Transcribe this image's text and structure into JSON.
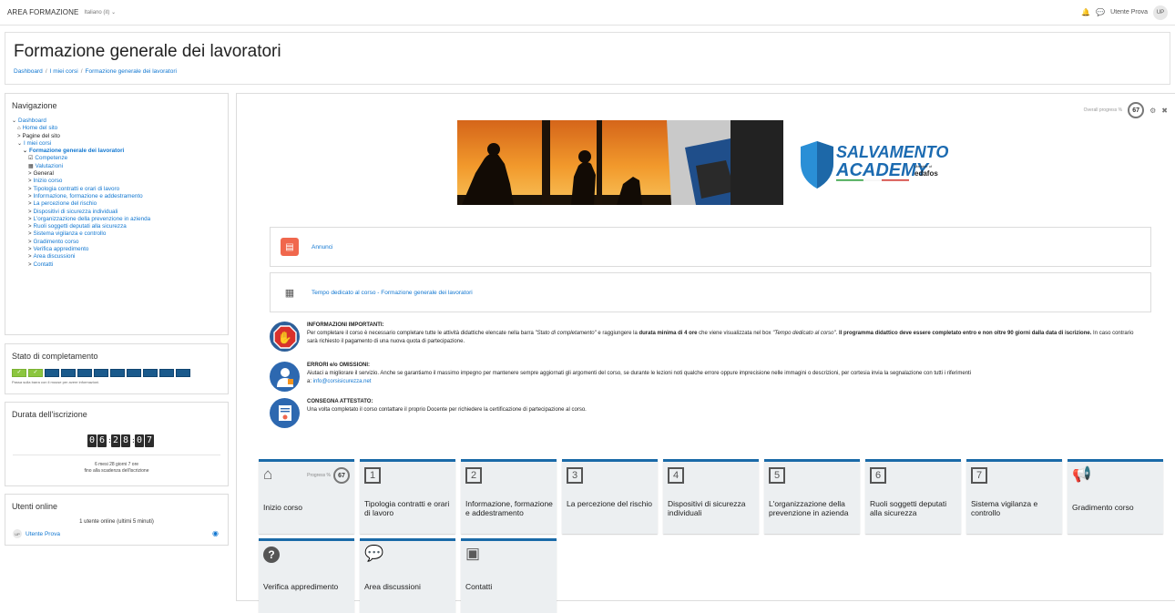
{
  "topbar": {
    "brand": "AREA FORMAZIONE",
    "language": "Italiano (it) ⌄",
    "user_name": "Utente Prova",
    "user_initials": "UP"
  },
  "header": {
    "title": "Formazione generale dei lavoratori",
    "breadcrumb": [
      "Dashboard",
      "I miei corsi",
      "Formazione generale dei lavoratori"
    ]
  },
  "navigation": {
    "title": "Navigazione",
    "items": [
      {
        "label": "Dashboard",
        "prefix": "⌄"
      },
      {
        "label": "Home del sito",
        "prefix": "⌂"
      },
      {
        "label": "Pagine del sito",
        "prefix": ">"
      },
      {
        "label": "I miei corsi",
        "prefix": "⌄"
      },
      {
        "label": "Formazione generale dei lavoratori",
        "prefix": "⌄"
      },
      {
        "label": "Competenze",
        "prefix": "☑"
      },
      {
        "label": "Valutazioni",
        "prefix": "▦"
      },
      {
        "label": "General",
        "prefix": ">"
      },
      {
        "label": "Inizio corso",
        "prefix": ">"
      },
      {
        "label": "Tipologia contratti e orari di lavoro",
        "prefix": ">"
      },
      {
        "label": "Informazione, formazione e addestramento",
        "prefix": ">"
      },
      {
        "label": "La percezione del rischio",
        "prefix": ">"
      },
      {
        "label": "Dispositivi di sicurezza individuali",
        "prefix": ">"
      },
      {
        "label": "L'organizzazione della prevenzione in azienda",
        "prefix": ">"
      },
      {
        "label": "Ruoli soggetti deputati alla sicurezza",
        "prefix": ">"
      },
      {
        "label": "Sistema vigilanza e controllo",
        "prefix": ">"
      },
      {
        "label": "Gradimento corso",
        "prefix": ">"
      },
      {
        "label": "Verifica appredimento",
        "prefix": ">"
      },
      {
        "label": "Area discussioni",
        "prefix": ">"
      },
      {
        "label": "Contatti",
        "prefix": ">"
      }
    ]
  },
  "completion": {
    "title": "Stato di completamento",
    "completed": 2,
    "total": 11,
    "check": "✓",
    "hint": "Passa sulla barra con il mouse per avere informazioni."
  },
  "duration": {
    "title": "Durata dell'iscrizione",
    "digits": [
      "0",
      "6",
      "2",
      "8",
      "0",
      "7"
    ],
    "remaining_line1": "6 mesi 28 giorni 7 ore",
    "remaining_line2": "fino alla scadenza dell'iscrizione"
  },
  "online_users": {
    "title": "Utenti online",
    "count_text": "1 utente online (ultimi 5 minuti)",
    "user_name": "Utente Prova",
    "user_initials": "UP"
  },
  "main": {
    "overall_progress_label": "Overall progress %",
    "overall_progress_value": "67",
    "logo_line1": "SALVAMENTO",
    "logo_line2": "ACADEMY",
    "logo_member": "Member of",
    "logo_brand": "edafos",
    "activities": [
      {
        "label": "Annunci"
      },
      {
        "label": "Tempo dedicato al corso - Formazione generale dei lavoratori"
      }
    ],
    "info": [
      {
        "heading": "INFORMAZIONI IMPORTANTI:",
        "p1": "Per completare il corso è necessario completare tutte le attività didattiche elencate nella barra ",
        "p1_em": "\"Stato di completamento\"",
        "p2": " e raggiungere la ",
        "p2_b": "durata minima di 4 ore",
        "p3": " che viene visualizzata nel box ",
        "p3_em": "\"Tempo dedicato al corso\"",
        "p4": ". ",
        "p4_b": "Il programma didattico deve essere completato entro e non oltre 90 giorni dalla data di iscrizione.",
        "p5": " In caso contrario sarà richiesto il pagamento di una nuova quota di partecipazione."
      },
      {
        "heading": "ERRORI e/o OMISSIONI:",
        "text": "Aiutaci a migliorare il servizio. Anche se garantiamo il massimo impegno per mantenere sempre aggiornati gli argomenti del corso, se durante le lezioni noti qualche errore oppure imprecisione nelle immagini o descrizioni, per cortesia invia la segnalazione con tutti i riferimenti",
        "email_prefix": "a: ",
        "email": "info@corsisicurezza.net"
      },
      {
        "heading": "CONSEGNA ATTESTATO:",
        "text": "Una volta completato il corso contattare il proprio Docente per richiedere la certificazione di partecipazione al corso."
      }
    ],
    "tiles": [
      {
        "label": "Inizio corso",
        "icon": "home-icon",
        "progress_label": "Progress %",
        "progress": "67"
      },
      {
        "label": "Tipologia contratti e orari di lavoro",
        "number": "1"
      },
      {
        "label": "Informazione, formazione e addestramento",
        "number": "2"
      },
      {
        "label": "La percezione del rischio",
        "number": "3"
      },
      {
        "label": "Dispositivi di sicurezza individuali",
        "number": "4"
      },
      {
        "label": "L'organizzazione della prevenzione in azienda",
        "number": "5"
      },
      {
        "label": "Ruoli soggetti deputati alla sicurezza",
        "number": "6"
      },
      {
        "label": "Sistema vigilanza e controllo",
        "number": "7"
      },
      {
        "label": "Gradimento corso",
        "icon": "megaphone-icon"
      },
      {
        "label": "Verifica appredimento",
        "icon": "question-icon"
      },
      {
        "label": "Area discussioni",
        "icon": "chat-icon"
      },
      {
        "label": "Contatti",
        "icon": "contact-card-icon"
      }
    ]
  },
  "colors": {
    "link": "#1177d1",
    "tile_accent": "#1a6aa8",
    "bar_done": "#8cc63f",
    "bar_todo": "#1a5a8c"
  }
}
